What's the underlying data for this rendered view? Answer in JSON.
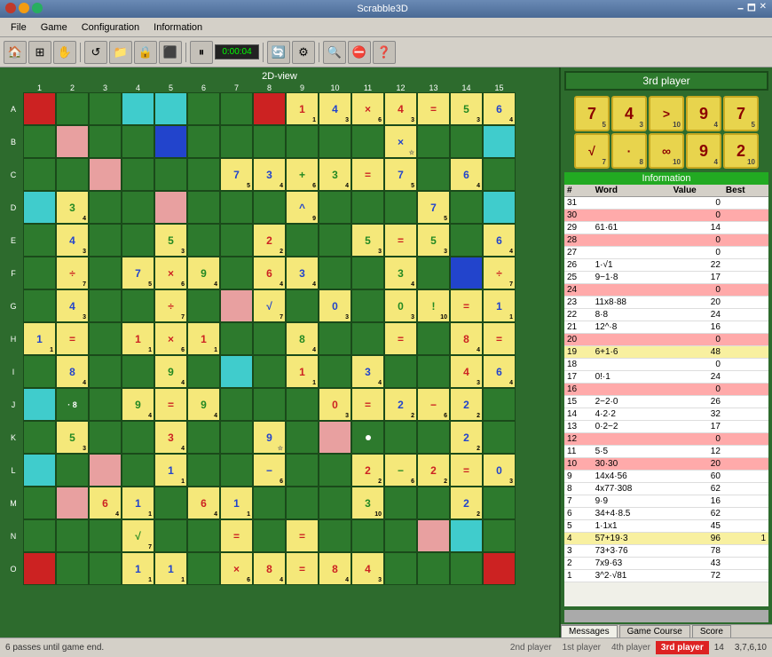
{
  "titlebar": {
    "title": "Scrabble3D",
    "close": "✕",
    "min": "−",
    "max": "□"
  },
  "menubar": {
    "items": [
      "File",
      "Game",
      "Configuration",
      "Information"
    ]
  },
  "toolbar": {
    "timer": "0:00:04"
  },
  "board": {
    "title": "2D-view",
    "col_labels": [
      "1",
      "2",
      "3",
      "4",
      "5",
      "6",
      "7",
      "8",
      "9",
      "10",
      "11",
      "12",
      "13",
      "14",
      "15"
    ],
    "row_labels": [
      "A",
      "B",
      "C",
      "D",
      "E",
      "F",
      "G",
      "H",
      "I",
      "J",
      "K",
      "L",
      "M",
      "N",
      "O"
    ]
  },
  "player_panel": {
    "title": "3rd player",
    "tile_row1": [
      {
        "val": "7",
        "sub": "5"
      },
      {
        "val": "4",
        "sub": "3"
      },
      {
        "val": ">",
        "sub": "10",
        "special": true
      },
      {
        "val": "9",
        "sub": "4"
      },
      {
        "val": "7",
        "sub": "5"
      }
    ],
    "tile_row2": [
      {
        "val": "√",
        "sub": "7",
        "special": true
      },
      {
        "val": "·",
        "sub": "8",
        "special": true
      },
      {
        "val": "∞",
        "sub": "10",
        "special": true
      },
      {
        "val": "9",
        "sub": "4"
      },
      {
        "val": "2",
        "sub": "10"
      }
    ]
  },
  "info": {
    "title": "Information",
    "headers": [
      "#",
      "Word",
      "Value",
      "Best"
    ],
    "rows": [
      {
        "num": "31",
        "word": "",
        "value": "0",
        "best": "",
        "style": "normal"
      },
      {
        "num": "30",
        "word": "",
        "value": "0",
        "best": "",
        "style": "red"
      },
      {
        "num": "29",
        "word": "61·61",
        "value": "14",
        "best": "",
        "style": "normal"
      },
      {
        "num": "28",
        "word": "",
        "value": "0",
        "best": "",
        "style": "red"
      },
      {
        "num": "27",
        "word": "",
        "value": "0",
        "best": "",
        "style": "normal"
      },
      {
        "num": "26",
        "word": "1·√1",
        "value": "22",
        "best": "",
        "style": "normal"
      },
      {
        "num": "25",
        "word": "9−1·8",
        "value": "17",
        "best": "",
        "style": "normal"
      },
      {
        "num": "24",
        "word": "",
        "value": "0",
        "best": "",
        "style": "red"
      },
      {
        "num": "23",
        "word": "11x8·88",
        "value": "20",
        "best": "",
        "style": "normal"
      },
      {
        "num": "22",
        "word": "8·8",
        "value": "24",
        "best": "",
        "style": "normal"
      },
      {
        "num": "21",
        "word": "12^·8",
        "value": "16",
        "best": "",
        "style": "normal"
      },
      {
        "num": "20",
        "word": "",
        "value": "0",
        "best": "",
        "style": "red"
      },
      {
        "num": "19",
        "word": "6+1·6",
        "value": "48",
        "best": "",
        "style": "yellow"
      },
      {
        "num": "18",
        "word": "",
        "value": "0",
        "best": "",
        "style": "normal"
      },
      {
        "num": "17",
        "word": "0!·1",
        "value": "24",
        "best": "",
        "style": "normal"
      },
      {
        "num": "16",
        "word": "",
        "value": "0",
        "best": "",
        "style": "red"
      },
      {
        "num": "15",
        "word": "2−2·0",
        "value": "26",
        "best": "",
        "style": "normal"
      },
      {
        "num": "14",
        "word": "4·2·2",
        "value": "32",
        "best": "",
        "style": "normal"
      },
      {
        "num": "13",
        "word": "0·2−2",
        "value": "17",
        "best": "",
        "style": "normal"
      },
      {
        "num": "12",
        "word": "",
        "value": "0",
        "best": "",
        "style": "red"
      },
      {
        "num": "11",
        "word": "5·5",
        "value": "12",
        "best": "",
        "style": "normal"
      },
      {
        "num": "10",
        "word": "30·30",
        "value": "20",
        "best": "",
        "style": "red"
      },
      {
        "num": "9",
        "word": "14x4·56",
        "value": "60",
        "best": "",
        "style": "normal"
      },
      {
        "num": "8",
        "word": "4x77·308",
        "value": "62",
        "best": "",
        "style": "normal"
      },
      {
        "num": "7",
        "word": "9·9",
        "value": "16",
        "best": "",
        "style": "normal"
      },
      {
        "num": "6",
        "word": "34+4·8.5",
        "value": "62",
        "best": "",
        "style": "normal"
      },
      {
        "num": "5",
        "word": "1·1x1",
        "value": "45",
        "best": "",
        "style": "normal"
      },
      {
        "num": "4",
        "word": "57+19·3",
        "value": "96",
        "best": "1",
        "style": "yellow"
      },
      {
        "num": "3",
        "word": "73+3·76",
        "value": "78",
        "best": "",
        "style": "normal"
      },
      {
        "num": "2",
        "word": "7x9·63",
        "value": "43",
        "best": "",
        "style": "normal"
      },
      {
        "num": "1",
        "word": "3^2·√81",
        "value": "72",
        "best": "",
        "style": "normal"
      }
    ]
  },
  "tabs": {
    "messages": "Messages",
    "game_course": "Game Course",
    "score": "Score"
  },
  "statusbar": {
    "left": "6 passes until game end.",
    "players": [
      {
        "label": "2nd player",
        "class": "pi-2nd"
      },
      {
        "label": "1st player",
        "class": "pi-1st"
      },
      {
        "label": "4th player",
        "class": "pi-4th"
      },
      {
        "label": "3rd player",
        "class": "pi-3rd"
      }
    ],
    "score_label": "14",
    "score_vals": "3,7,6,10"
  }
}
